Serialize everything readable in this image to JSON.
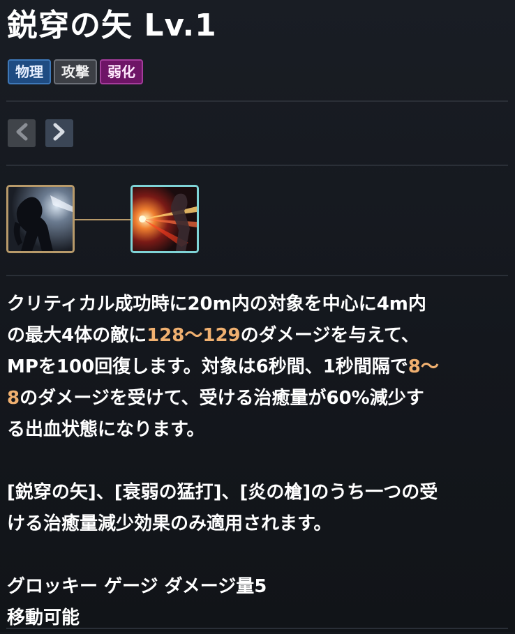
{
  "skill": {
    "name": "鋭穿の矢",
    "level": "Lv.1",
    "tags": [
      {
        "label": "物理",
        "color": "#1f4c82"
      },
      {
        "label": "攻撃",
        "color": "#3c3f45"
      },
      {
        "label": "弱化",
        "color": "#6e1466"
      }
    ]
  },
  "icons": {
    "prev": "chevron-left-icon",
    "next": "chevron-right-icon",
    "node_1": "shadow-warrior-skill-icon",
    "node_2": "piercing-arrow-skill-icon"
  },
  "description": {
    "para1": {
      "line1": "クリティカル成功時に20m内の対象を中心に4m内",
      "line2_a": "の最大4体の敵に",
      "damage": "128〜129",
      "line2_b": "のダメージを与えて、",
      "line3_a": "MPを100回復します。対象は6秒間、1秒間隔で",
      "bleed_a": "8〜",
      "bleed_b": "8",
      "line4_b": "のダメージを受けて、受ける治癒量が60%減少す",
      "line5": "る出血状態になります。"
    },
    "para2": {
      "line1": "[鋭穿の矢]、[衰弱の猛打]、[炎の槍]のうち一つの受",
      "line2": "ける治癒量減少効果のみ適用されます。"
    },
    "groggy": "グロッキー ゲージ ダメージ量5",
    "mobility": "移動可能"
  },
  "colors": {
    "highlight": "#f0b070",
    "mobility": "#f4c430",
    "node_border_learned": "#b89a6a",
    "node_border_selected": "#7fd3d6"
  }
}
